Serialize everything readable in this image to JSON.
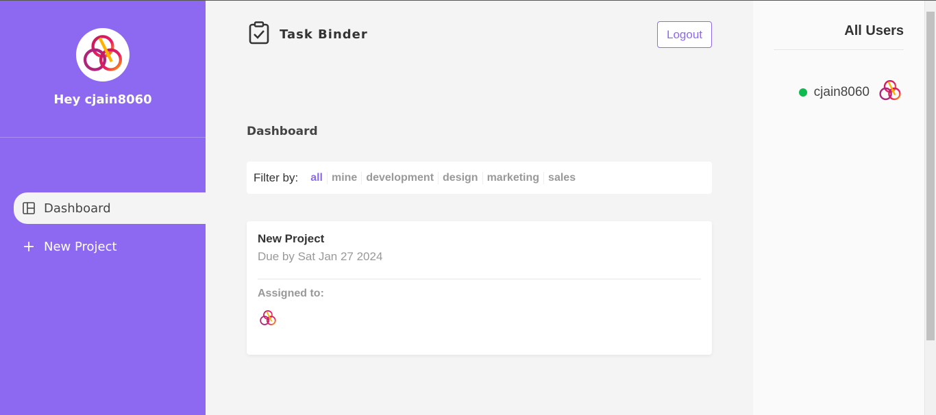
{
  "sidebar": {
    "greeting": "Hey cjain8060",
    "nav": [
      {
        "label": "Dashboard",
        "icon": "dashboard-icon",
        "active": true
      },
      {
        "label": "New Project",
        "icon": "plus-icon",
        "active": false
      }
    ]
  },
  "header": {
    "app_name": "Task Binder",
    "logout_label": "Logout"
  },
  "main": {
    "title": "Dashboard",
    "filter": {
      "label": "Filter by:",
      "options": [
        "all",
        "mine",
        "development",
        "design",
        "marketing",
        "sales"
      ],
      "active": "all"
    },
    "projects": [
      {
        "name": "New Project",
        "due": "Due by Sat Jan 27 2024",
        "assigned_label": "Assigned to:"
      }
    ]
  },
  "online_users": {
    "title": "All Users",
    "users": [
      {
        "name": "cjain8060",
        "online": true
      }
    ]
  },
  "colors": {
    "accent": "#8d69f1",
    "online": "#0ebb50",
    "background": "#f4f4f4"
  }
}
